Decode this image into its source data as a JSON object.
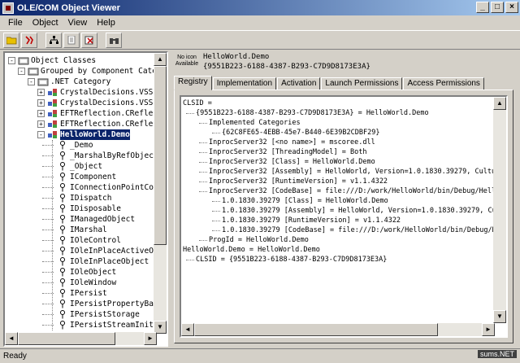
{
  "window": {
    "title": "OLE/COM Object Viewer"
  },
  "menu": [
    "File",
    "Object",
    "View",
    "Help"
  ],
  "window_buttons": [
    "_",
    "□",
    "×"
  ],
  "tree": {
    "items": [
      {
        "label": "Object Classes",
        "expander": "-"
      },
      {
        "label": "Grouped by Component Category",
        "expander": "-"
      },
      {
        "label": ".NET Category",
        "expander": "-"
      },
      {
        "label": "CrystalDecisions.VSSh",
        "expander": "+"
      },
      {
        "label": "CrystalDecisions.VSSh",
        "expander": "+"
      },
      {
        "label": "EFTReflection.CReflect",
        "expander": "+"
      },
      {
        "label": "EFTReflection.CReflect",
        "expander": "+"
      },
      {
        "label": "HelloWorld.Demo",
        "expander": "-",
        "selected": true
      },
      {
        "label": "_Demo"
      },
      {
        "label": "_MarshalByRefObjec"
      },
      {
        "label": "_Object"
      },
      {
        "label": "IComponent"
      },
      {
        "label": "IConnectionPointCo"
      },
      {
        "label": "IDispatch"
      },
      {
        "label": "IDisposable"
      },
      {
        "label": "IManagedObject"
      },
      {
        "label": "IMarshal"
      },
      {
        "label": "IOleControl"
      },
      {
        "label": "IOleInPlaceActiveO"
      },
      {
        "label": "IOleInPlaceObject"
      },
      {
        "label": "IOleObject"
      },
      {
        "label": "IOleWindow"
      },
      {
        "label": "IPersist"
      },
      {
        "label": "IPersistPropertyBa"
      },
      {
        "label": "IPersistStorage"
      },
      {
        "label": "IPersistStreamInit"
      }
    ]
  },
  "header": {
    "no_icon_text": "No icon Available",
    "name": "HelloWorld.Demo",
    "clsid": "{9551B223-6188-4387-B293-C7D9D8173E3A}"
  },
  "tabs": [
    "Registry",
    "Implementation",
    "Activation",
    "Launch Permissions",
    "Access Permissions"
  ],
  "registry_lines": [
    {
      "text": "CLSID =",
      "indent": 0
    },
    {
      "text": "{9551B223-6188-4387-B293-C7D9D8173E3A} = HelloWorld.Demo",
      "indent": 1
    },
    {
      "text": "Implemented Categories",
      "indent": 2
    },
    {
      "text": "{62C8FE65-4EBB-45e7-B440-6E39B2CDBF29}",
      "indent": 3
    },
    {
      "text": "InprocServer32 [<no name>] = mscoree.dll",
      "indent": 2
    },
    {
      "text": "InprocServer32 [ThreadingModel] = Both",
      "indent": 2
    },
    {
      "text": "InprocServer32 [Class] = HelloWorld.Demo",
      "indent": 2
    },
    {
      "text": "InprocServer32 [Assembly] = HelloWorld, Version=1.0.1830.39279, Culture=ne",
      "indent": 2
    },
    {
      "text": "InprocServer32 [RuntimeVersion] = v1.1.4322",
      "indent": 2
    },
    {
      "text": "InprocServer32 [CodeBase] = file:///D:/work/HelloWorld/bin/Debug/HelloWor",
      "indent": 2
    },
    {
      "text": "1.0.1830.39279 [Class] = HelloWorld.Demo",
      "indent": 3
    },
    {
      "text": "1.0.1830.39279 [Assembly] = HelloWorld, Version=1.0.1830.39279, Culture",
      "indent": 3
    },
    {
      "text": "1.0.1830.39279 [RuntimeVersion] = v1.1.4322",
      "indent": 3
    },
    {
      "text": "1.0.1830.39279 [CodeBase] = file:///D:/work/HelloWorld/bin/Debug/HelloW",
      "indent": 3
    },
    {
      "text": "ProgId = HelloWorld.Demo",
      "indent": 2
    },
    {
      "text": "HelloWorld.Demo = HelloWorld.Demo",
      "indent": 0
    },
    {
      "text": "CLSID = {9551B223-6188-4387-B293-C7D9D8173E3A}",
      "indent": 1
    }
  ],
  "status": {
    "text": "Ready"
  },
  "watermark": "sums.NET",
  "colors": {
    "selection": "#0a246a",
    "titlebar": "#0a246a",
    "face": "#d4d0c8"
  },
  "icons": {
    "toolbar": [
      "open-folder-icon",
      "connect-icon",
      "tree-view-icon",
      "copy-icon",
      "release-icon",
      "binoculars-icon"
    ],
    "tree_folder": "component-category-icon",
    "tree_class": "coclass-icon",
    "tree_interface": "interface-lollipop-icon"
  }
}
